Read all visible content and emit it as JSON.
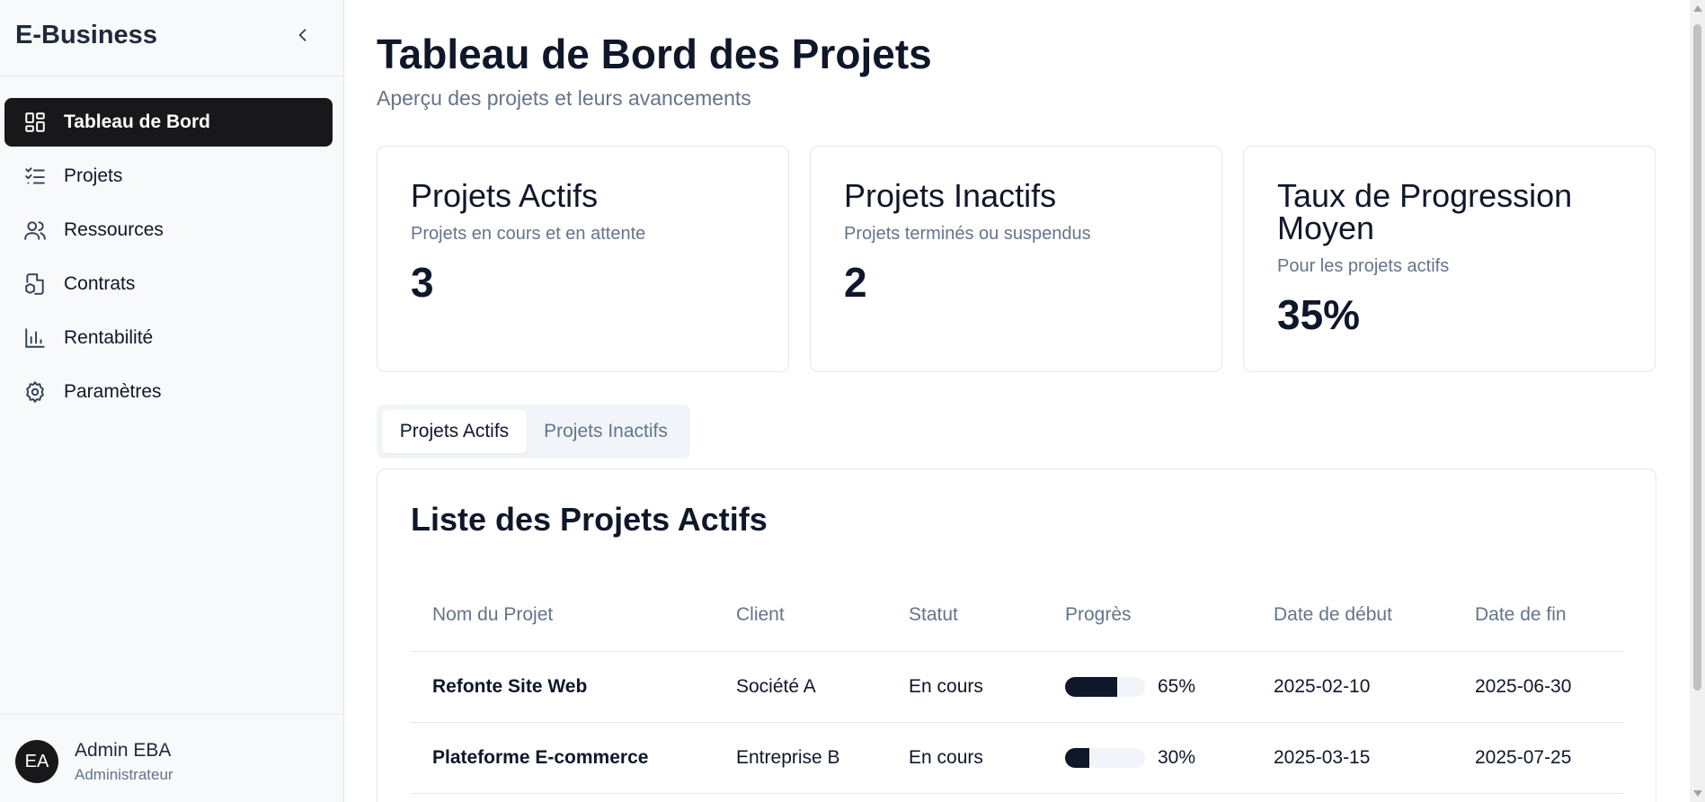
{
  "sidebar": {
    "brand": "E-Business",
    "items": [
      {
        "label": "Tableau de Bord",
        "icon": "dashboard-icon",
        "active": true
      },
      {
        "label": "Projets",
        "icon": "checklist-icon",
        "active": false
      },
      {
        "label": "Ressources",
        "icon": "users-icon",
        "active": false
      },
      {
        "label": "Contrats",
        "icon": "contract-icon",
        "active": false
      },
      {
        "label": "Rentabilité",
        "icon": "bar-chart-icon",
        "active": false
      },
      {
        "label": "Paramètres",
        "icon": "gear-icon",
        "active": false
      }
    ],
    "user": {
      "initials": "EA",
      "name": "Admin EBA",
      "role": "Administrateur"
    }
  },
  "main": {
    "title": "Tableau de Bord des Projets",
    "subtitle": "Aperçu des projets et leurs avancements",
    "cards": [
      {
        "title": "Projets Actifs",
        "description": "Projets en cours et en attente",
        "value": "3"
      },
      {
        "title": "Projets Inactifs",
        "description": "Projets terminés ou suspendus",
        "value": "2"
      },
      {
        "title": "Taux de Progression Moyen",
        "description": "Pour les projets actifs",
        "value": "35%"
      }
    ],
    "tabs": [
      {
        "label": "Projets Actifs",
        "active": true
      },
      {
        "label": "Projets Inactifs",
        "active": false
      }
    ],
    "list": {
      "title": "Liste des Projets Actifs",
      "columns": [
        "Nom du Projet",
        "Client",
        "Statut",
        "Progrès",
        "Date de début",
        "Date de fin"
      ],
      "rows": [
        {
          "name": "Refonte Site Web",
          "client": "Société A",
          "status": "En cours",
          "progress": 65,
          "progress_label": "65%",
          "start": "2025-02-10",
          "end": "2025-06-30"
        },
        {
          "name": "Plateforme E-commerce",
          "client": "Entreprise B",
          "status": "En cours",
          "progress": 30,
          "progress_label": "30%",
          "start": "2025-03-15",
          "end": "2025-07-25"
        }
      ]
    }
  },
  "colors": {
    "accent": "#18181b",
    "muted_text": "#64748b",
    "border": "#e2e8f0"
  }
}
